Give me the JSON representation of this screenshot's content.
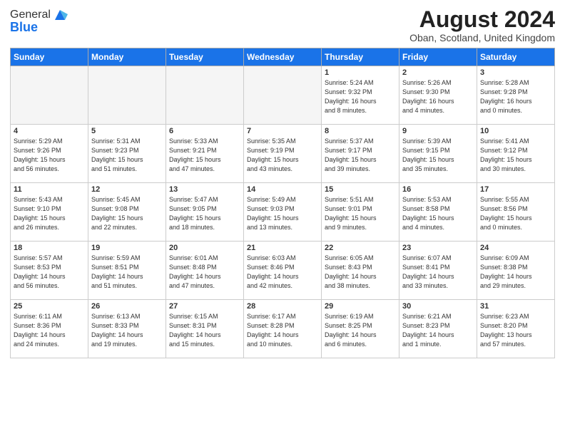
{
  "logo": {
    "general": "General",
    "blue": "Blue"
  },
  "title": {
    "month_year": "August 2024",
    "location": "Oban, Scotland, United Kingdom"
  },
  "days_of_week": [
    "Sunday",
    "Monday",
    "Tuesday",
    "Wednesday",
    "Thursday",
    "Friday",
    "Saturday"
  ],
  "weeks": [
    [
      {
        "day": "",
        "info": ""
      },
      {
        "day": "",
        "info": ""
      },
      {
        "day": "",
        "info": ""
      },
      {
        "day": "",
        "info": ""
      },
      {
        "day": "1",
        "info": "Sunrise: 5:24 AM\nSunset: 9:32 PM\nDaylight: 16 hours\nand 8 minutes."
      },
      {
        "day": "2",
        "info": "Sunrise: 5:26 AM\nSunset: 9:30 PM\nDaylight: 16 hours\nand 4 minutes."
      },
      {
        "day": "3",
        "info": "Sunrise: 5:28 AM\nSunset: 9:28 PM\nDaylight: 16 hours\nand 0 minutes."
      }
    ],
    [
      {
        "day": "4",
        "info": "Sunrise: 5:29 AM\nSunset: 9:26 PM\nDaylight: 15 hours\nand 56 minutes."
      },
      {
        "day": "5",
        "info": "Sunrise: 5:31 AM\nSunset: 9:23 PM\nDaylight: 15 hours\nand 51 minutes."
      },
      {
        "day": "6",
        "info": "Sunrise: 5:33 AM\nSunset: 9:21 PM\nDaylight: 15 hours\nand 47 minutes."
      },
      {
        "day": "7",
        "info": "Sunrise: 5:35 AM\nSunset: 9:19 PM\nDaylight: 15 hours\nand 43 minutes."
      },
      {
        "day": "8",
        "info": "Sunrise: 5:37 AM\nSunset: 9:17 PM\nDaylight: 15 hours\nand 39 minutes."
      },
      {
        "day": "9",
        "info": "Sunrise: 5:39 AM\nSunset: 9:15 PM\nDaylight: 15 hours\nand 35 minutes."
      },
      {
        "day": "10",
        "info": "Sunrise: 5:41 AM\nSunset: 9:12 PM\nDaylight: 15 hours\nand 30 minutes."
      }
    ],
    [
      {
        "day": "11",
        "info": "Sunrise: 5:43 AM\nSunset: 9:10 PM\nDaylight: 15 hours\nand 26 minutes."
      },
      {
        "day": "12",
        "info": "Sunrise: 5:45 AM\nSunset: 9:08 PM\nDaylight: 15 hours\nand 22 minutes."
      },
      {
        "day": "13",
        "info": "Sunrise: 5:47 AM\nSunset: 9:05 PM\nDaylight: 15 hours\nand 18 minutes."
      },
      {
        "day": "14",
        "info": "Sunrise: 5:49 AM\nSunset: 9:03 PM\nDaylight: 15 hours\nand 13 minutes."
      },
      {
        "day": "15",
        "info": "Sunrise: 5:51 AM\nSunset: 9:01 PM\nDaylight: 15 hours\nand 9 minutes."
      },
      {
        "day": "16",
        "info": "Sunrise: 5:53 AM\nSunset: 8:58 PM\nDaylight: 15 hours\nand 4 minutes."
      },
      {
        "day": "17",
        "info": "Sunrise: 5:55 AM\nSunset: 8:56 PM\nDaylight: 15 hours\nand 0 minutes."
      }
    ],
    [
      {
        "day": "18",
        "info": "Sunrise: 5:57 AM\nSunset: 8:53 PM\nDaylight: 14 hours\nand 56 minutes."
      },
      {
        "day": "19",
        "info": "Sunrise: 5:59 AM\nSunset: 8:51 PM\nDaylight: 14 hours\nand 51 minutes."
      },
      {
        "day": "20",
        "info": "Sunrise: 6:01 AM\nSunset: 8:48 PM\nDaylight: 14 hours\nand 47 minutes."
      },
      {
        "day": "21",
        "info": "Sunrise: 6:03 AM\nSunset: 8:46 PM\nDaylight: 14 hours\nand 42 minutes."
      },
      {
        "day": "22",
        "info": "Sunrise: 6:05 AM\nSunset: 8:43 PM\nDaylight: 14 hours\nand 38 minutes."
      },
      {
        "day": "23",
        "info": "Sunrise: 6:07 AM\nSunset: 8:41 PM\nDaylight: 14 hours\nand 33 minutes."
      },
      {
        "day": "24",
        "info": "Sunrise: 6:09 AM\nSunset: 8:38 PM\nDaylight: 14 hours\nand 29 minutes."
      }
    ],
    [
      {
        "day": "25",
        "info": "Sunrise: 6:11 AM\nSunset: 8:36 PM\nDaylight: 14 hours\nand 24 minutes."
      },
      {
        "day": "26",
        "info": "Sunrise: 6:13 AM\nSunset: 8:33 PM\nDaylight: 14 hours\nand 19 minutes."
      },
      {
        "day": "27",
        "info": "Sunrise: 6:15 AM\nSunset: 8:31 PM\nDaylight: 14 hours\nand 15 minutes."
      },
      {
        "day": "28",
        "info": "Sunrise: 6:17 AM\nSunset: 8:28 PM\nDaylight: 14 hours\nand 10 minutes."
      },
      {
        "day": "29",
        "info": "Sunrise: 6:19 AM\nSunset: 8:25 PM\nDaylight: 14 hours\nand 6 minutes."
      },
      {
        "day": "30",
        "info": "Sunrise: 6:21 AM\nSunset: 8:23 PM\nDaylight: 14 hours\nand 1 minute."
      },
      {
        "day": "31",
        "info": "Sunrise: 6:23 AM\nSunset: 8:20 PM\nDaylight: 13 hours\nand 57 minutes."
      }
    ]
  ]
}
